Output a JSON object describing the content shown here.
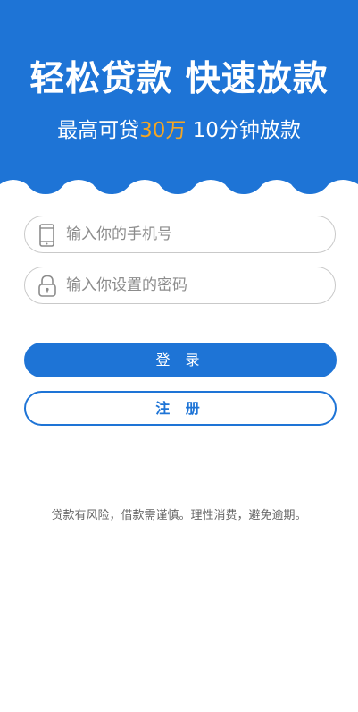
{
  "banner": {
    "headline": "轻松贷款 快速放款",
    "subline_prefix": "最高可贷",
    "subline_highlight": "30万",
    "subline_suffix": " 10分钟放款"
  },
  "form": {
    "phone": {
      "icon": "phone-icon",
      "value": "",
      "placeholder": "输入你的手机号"
    },
    "password": {
      "icon": "lock-icon",
      "value": "",
      "placeholder": "输入你设置的密码"
    }
  },
  "buttons": {
    "login_label": "登 录",
    "register_label": "注 册"
  },
  "disclaimer": "贷款有风险，借款需谨慎。理性消费，避免逾期。",
  "colors": {
    "primary": "#1e74d6",
    "highlight": "#f5a623",
    "border": "#c9c9c9"
  }
}
